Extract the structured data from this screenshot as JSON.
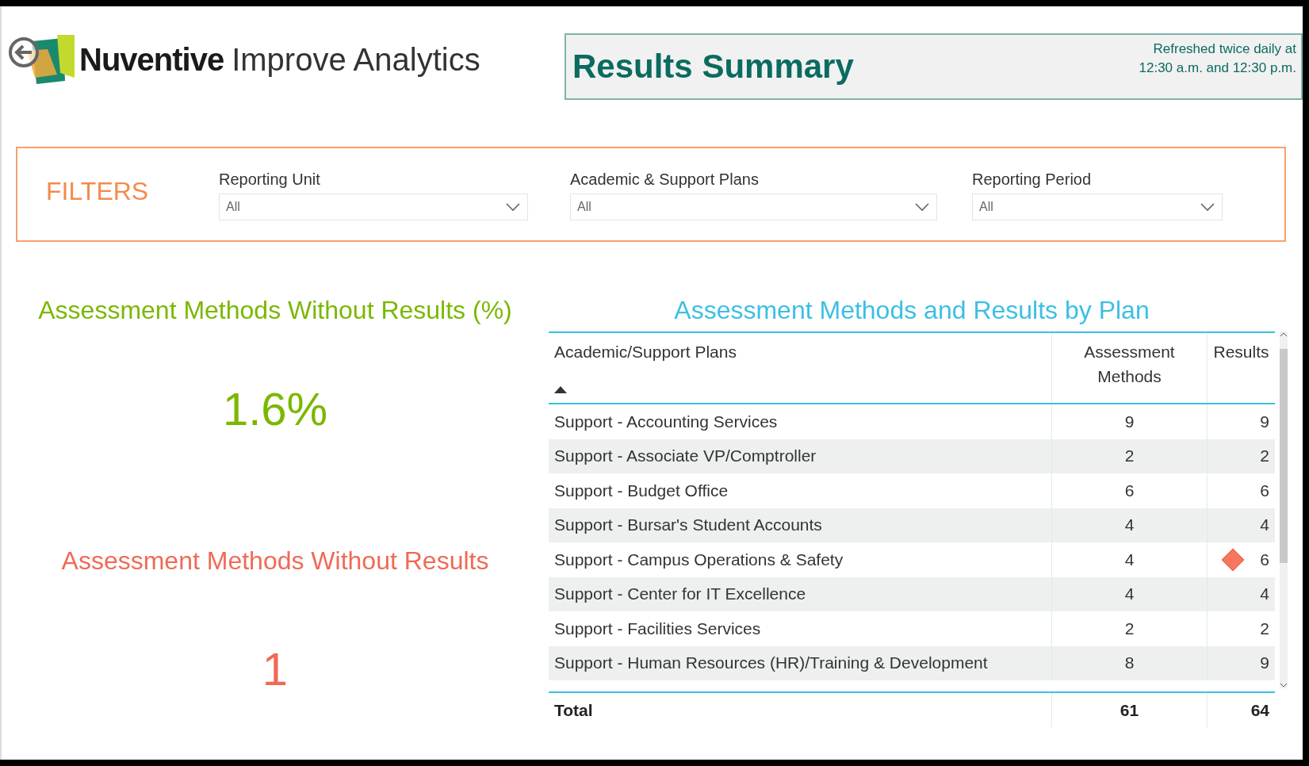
{
  "header": {
    "brand": "Nuventive",
    "product": "Improve Analytics"
  },
  "summary": {
    "title": "Results Summary",
    "refresh_line_1": "Refreshed twice daily at",
    "refresh_line_2": "12:30 a.m. and 12:30 p.m."
  },
  "filters": {
    "title": "FILTERS",
    "items": [
      {
        "label": "Reporting Unit",
        "value": "All"
      },
      {
        "label": "Academic & Support Plans",
        "value": "All"
      },
      {
        "label": "Reporting Period",
        "value": "All"
      }
    ]
  },
  "kpis": [
    {
      "kind": "percent",
      "title": "Assessment Methods Without Results (%)",
      "value": "1.6%",
      "color": "#7ab800"
    },
    {
      "kind": "count",
      "title": "Assessment Methods Without Results",
      "value": "1",
      "color": "#f06a55"
    }
  ],
  "table": {
    "title": "Assessment Methods and Results by Plan",
    "columns": [
      {
        "label": "Academic/Support Plans",
        "sorted": true
      },
      {
        "label": "Assessment Methods",
        "sorted": false
      },
      {
        "label": "Results",
        "sorted": false
      }
    ],
    "rows": [
      {
        "plan": "Support - Accounting Services",
        "methods": "9",
        "results": "9",
        "warning": false
      },
      {
        "plan": "Support - Associate VP/Comptroller",
        "methods": "2",
        "results": "2",
        "warning": false
      },
      {
        "plan": "Support - Budget Office",
        "methods": "6",
        "results": "6",
        "warning": false
      },
      {
        "plan": "Support - Bursar's Student Accounts",
        "methods": "4",
        "results": "4",
        "warning": false
      },
      {
        "plan": "Support - Campus Operations & Safety",
        "methods": "4",
        "results": "6",
        "warning": true
      },
      {
        "plan": "Support - Center for IT Excellence",
        "methods": "4",
        "results": "4",
        "warning": false
      },
      {
        "plan": "Support - Facilities Services",
        "methods": "2",
        "results": "2",
        "warning": false
      },
      {
        "plan": "Support - Human Resources (HR)/Training & Development",
        "methods": "8",
        "results": "9",
        "warning": false
      }
    ],
    "total": {
      "label": "Total",
      "methods": "61",
      "results": "64"
    }
  }
}
